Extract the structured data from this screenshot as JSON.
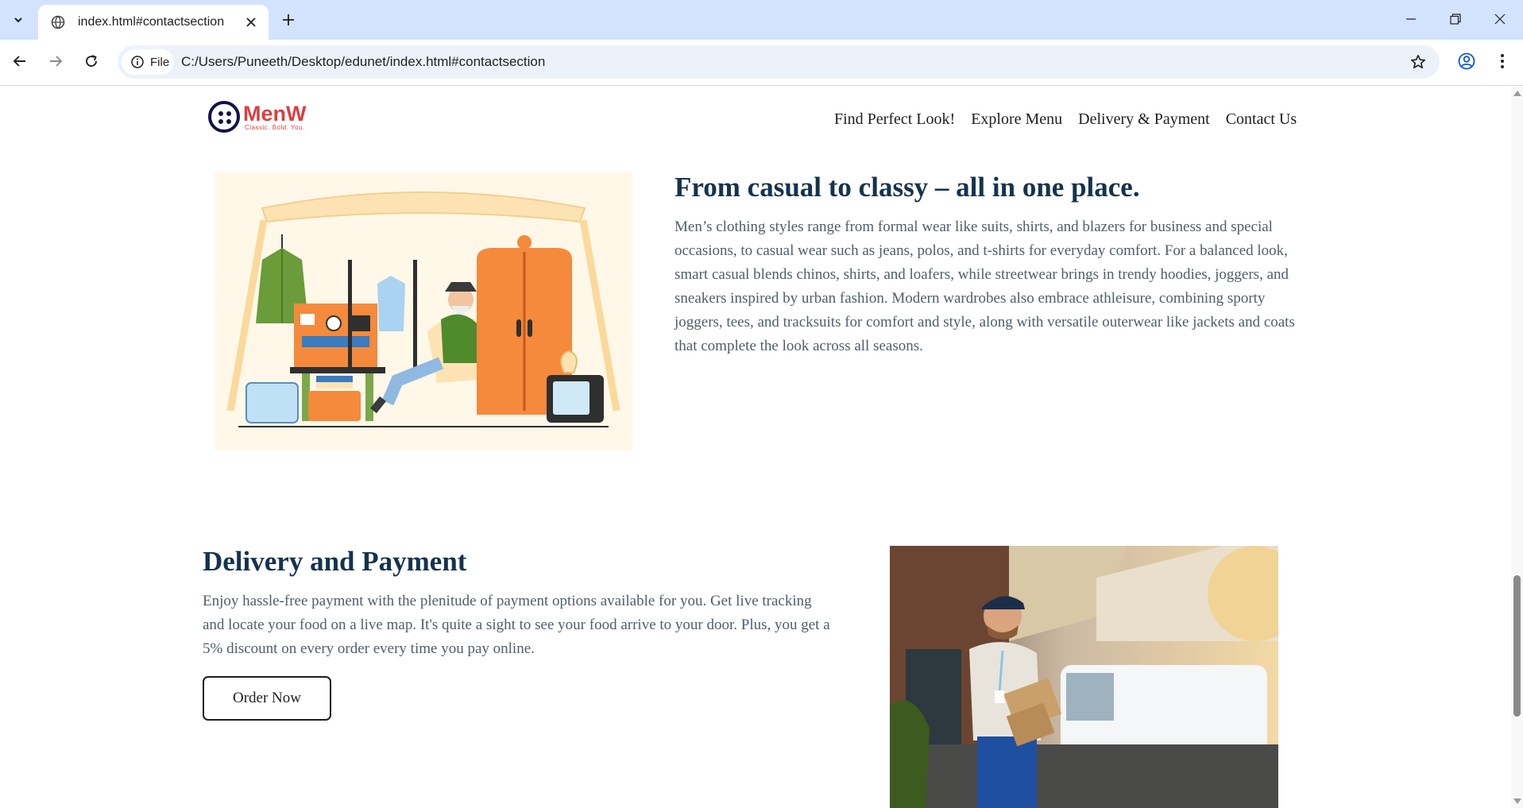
{
  "browser": {
    "tab_title": "index.html#contactsection",
    "chip_label": "File",
    "url": "C:/Users/Puneeth/Desktop/edunet/index.html#contactsection"
  },
  "site": {
    "logo": {
      "name": "MenW",
      "tagline": "Classic. Bold. You."
    },
    "nav": [
      "Find Perfect Look!",
      "Explore Menu",
      "Delivery & Payment",
      "Contact Us"
    ]
  },
  "section_styles": {
    "title": "From casual to classy – all in one place.",
    "text": "Men’s clothing styles range from formal wear like suits, shirts, and blazers for business and special occasions, to casual wear such as jeans, polos, and t-shirts for everyday comfort. For a balanced look, smart casual blends chinos, shirts, and loafers, while streetwear brings in trendy hoodies, joggers, and sneakers inspired by urban fashion. Modern wardrobes also embrace athleisure, combining sporty joggers, tees, and tracksuits for comfort and style, along with versatile outerwear like jackets and coats that complete the look across all seasons."
  },
  "section_delivery": {
    "title": "Delivery and Payment",
    "text": "Enjoy hassle-free payment with the plenitude of payment options available for you. Get live tracking and locate your food on a live map. It's quite a sight to see your food arrive to your door. Plus, you get a 5% discount on every order every time you pay online.",
    "button": "Order Now"
  },
  "colors": {
    "heading": "#15334f",
    "body_text": "#4f5e6b",
    "logo_red": "#d94040",
    "logo_navy": "#12124a",
    "tabstrip": "#d3e3fd"
  },
  "icons": [
    "tab-search-icon",
    "globe-icon",
    "close-icon",
    "plus-icon",
    "minimize-icon",
    "restore-icon",
    "close-window-icon",
    "back-arrow-icon",
    "forward-arrow-icon",
    "reload-icon",
    "info-icon",
    "star-icon",
    "profile-icon",
    "more-vert-icon"
  ]
}
